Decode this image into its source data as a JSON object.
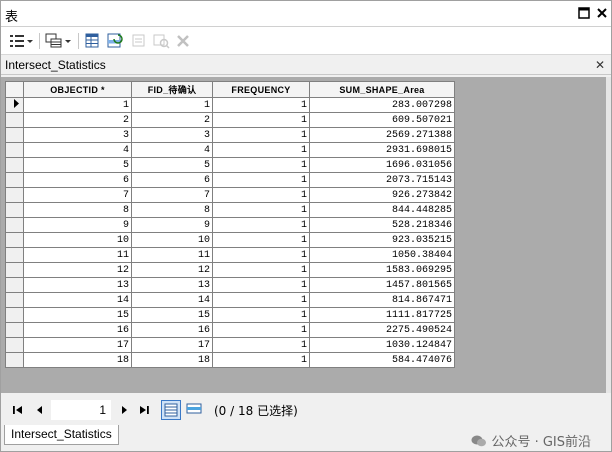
{
  "window": {
    "title": "表"
  },
  "panel": {
    "title": "Intersect_Statistics"
  },
  "columns": [
    "OBJECTID *",
    "FID_待确认",
    "FREQUENCY",
    "SUM_SHAPE_Area"
  ],
  "rows": [
    [
      "1",
      "1",
      "1",
      "283.007298"
    ],
    [
      "2",
      "2",
      "1",
      "609.507021"
    ],
    [
      "3",
      "3",
      "1",
      "2569.271388"
    ],
    [
      "4",
      "4",
      "1",
      "2931.698015"
    ],
    [
      "5",
      "5",
      "1",
      "1696.031056"
    ],
    [
      "6",
      "6",
      "1",
      "2073.715143"
    ],
    [
      "7",
      "7",
      "1",
      "926.273842"
    ],
    [
      "8",
      "8",
      "1",
      "844.448285"
    ],
    [
      "9",
      "9",
      "1",
      "528.218346"
    ],
    [
      "10",
      "10",
      "1",
      "923.035215"
    ],
    [
      "11",
      "11",
      "1",
      "1050.38404"
    ],
    [
      "12",
      "12",
      "1",
      "1583.069295"
    ],
    [
      "13",
      "13",
      "1",
      "1457.801565"
    ],
    [
      "14",
      "14",
      "1",
      "814.867471"
    ],
    [
      "15",
      "15",
      "1",
      "1111.817725"
    ],
    [
      "16",
      "16",
      "1",
      "2275.490524"
    ],
    [
      "17",
      "17",
      "1",
      "1030.124847"
    ],
    [
      "18",
      "18",
      "1",
      "584.474076"
    ]
  ],
  "current_row_index": 0,
  "navigator": {
    "current_record": "1",
    "status": "(0 / 18 已选择)"
  },
  "bottom_tab": {
    "label": "Intersect_Statistics"
  },
  "watermark": {
    "text": "公众号 · GIS前沿"
  },
  "icons": [
    "table-options-icon",
    "dropdown-arrow-icon",
    "related-tables-icon",
    "select-by-attributes-icon",
    "switch-selection-icon",
    "clear-selection-icon",
    "zoom-to-selected-icon",
    "delete-selected-icon",
    "window-restore-icon",
    "window-close-icon",
    "panel-close-icon",
    "first-record-icon",
    "previous-record-icon",
    "next-record-icon",
    "last-record-icon",
    "show-all-records-icon",
    "show-selected-records-icon",
    "current-row-arrow-icon",
    "wechat-icon"
  ],
  "colors": {
    "grid_bg": "#ababab",
    "header_bg": "#f4f4f4",
    "accent": "#3a78c6"
  }
}
